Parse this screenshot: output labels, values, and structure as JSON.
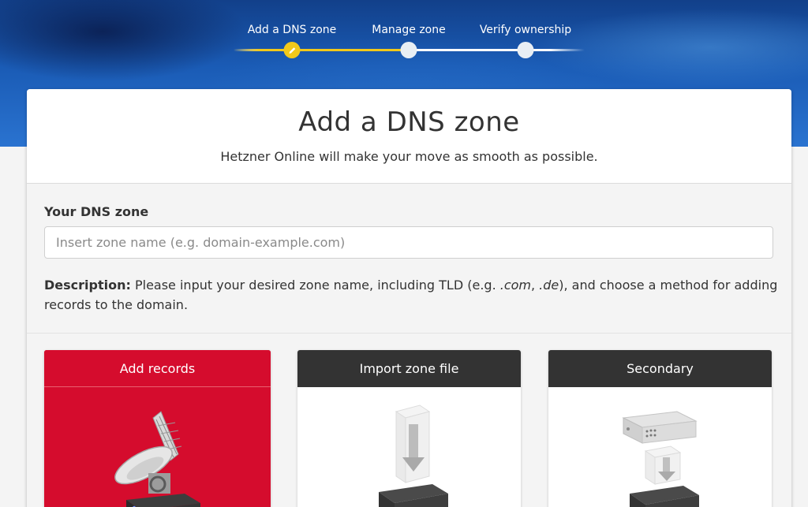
{
  "stepper": {
    "steps": [
      {
        "label": "Add a DNS zone",
        "state": "active"
      },
      {
        "label": "Manage zone",
        "state": "pending"
      },
      {
        "label": "Verify ownership",
        "state": "pending"
      }
    ],
    "active_color": "#f2c81a"
  },
  "card": {
    "title": "Add a DNS zone",
    "subtitle": "Hetzner Online will make your move as smooth as possible."
  },
  "form": {
    "label": "Your DNS zone",
    "input": {
      "value": "",
      "placeholder": "Insert zone name (e.g. domain-example.com)"
    },
    "description": {
      "prefix": "Description:",
      "text1": " Please input your desired zone name, including TLD (e.g. ",
      "ex1": ".com",
      "sep": ", ",
      "ex2": ".de",
      "text2": "), and choose a method for adding records to the domain."
    }
  },
  "options": [
    {
      "label": "Add records",
      "selected": true,
      "icon": "satellite-dish-icon"
    },
    {
      "label": "Import zone file",
      "selected": false,
      "icon": "import-file-icon"
    },
    {
      "label": "Secondary",
      "selected": false,
      "icon": "secondary-server-icon"
    }
  ],
  "colors": {
    "selected_option": "#d50c2d",
    "option_header": "#333333",
    "hero_blue": "#1a5bb5"
  }
}
